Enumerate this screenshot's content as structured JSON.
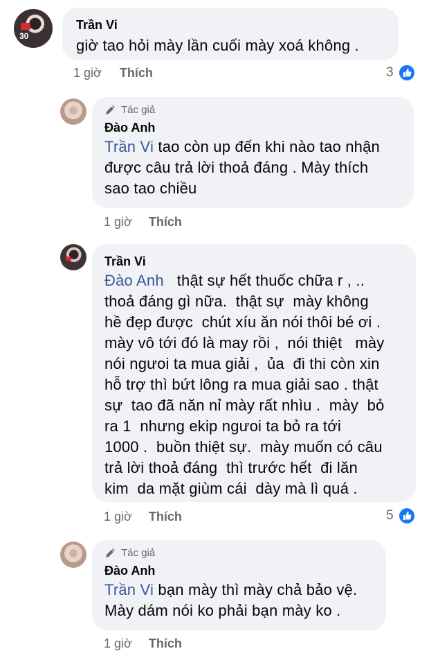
{
  "comments": [
    {
      "author": "Trần Vi",
      "text": "giờ tao hỏi mày lần cuối mày xoá không .",
      "time": "1 giờ",
      "like_label": "Thích",
      "reaction_count": "3",
      "avatar_badge": "30"
    },
    {
      "author_tag": "Tác giả",
      "author": "Đào Anh",
      "mention": "Trần Vi",
      "text": " tao còn up đến khi nào tao nhận\nđược câu trả lời thoả đáng . Mày thích\nsao tao chiều",
      "time": "1 giờ",
      "like_label": "Thích"
    },
    {
      "author": "Trần Vi",
      "mention": "Đào Anh",
      "text": "   thật sự hết thuốc chữa r , ..\nthoả đáng gì nữa.  thật sự  mày không\nhề đẹp được  chút xíu ăn nói thôi bé ơi .\nmày vô tới đó là may rồi ,  nói thiệt   mày\nnói ngưoi ta mua giải ,  ủa  đi thi còn xin\nhỗ trợ thì bứt lông ra mua giải sao . thật\nsự  tao đã năn nỉ mày rất nhìu .  mày  bỏ\nra 1  nhưng ekip ngưoi ta bỏ ra tới\n1000 .  buồn thiệt sự.  mày muốn có câu\ntrả lời thoả đáng  thì trước hết  đi lăn\nkim  da mặt giùm cái  dày mà lì quá .",
      "time": "1 giờ",
      "like_label": "Thích",
      "reaction_count": "5"
    },
    {
      "author_tag": "Tác giả",
      "author": "Đào Anh",
      "mention": "Trần Vi",
      "text": " bạn mày thì mày chả bảo vệ.\nMày dám nói ko phải bạn mày ko .",
      "time": "1 giờ",
      "like_label": "Thích"
    }
  ],
  "colors": {
    "bubble": "#f0f2f5",
    "mention": "#385898",
    "meta": "#65676b",
    "like_blue": "#1877f2"
  }
}
